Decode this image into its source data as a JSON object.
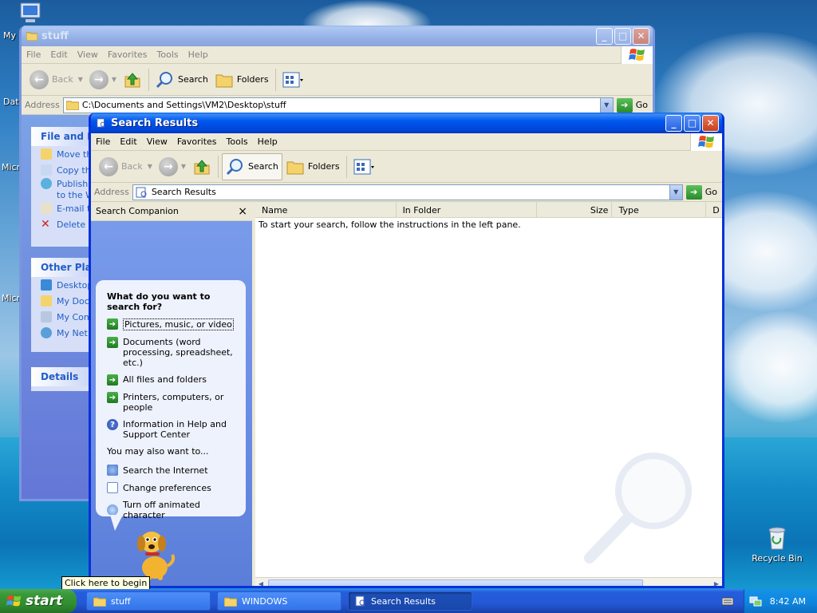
{
  "desktop": {
    "icons": [
      {
        "label": "My",
        "name": "my-computer-icon"
      },
      {
        "label": "Dat",
        "name": "data-icon"
      },
      {
        "label": "Micr",
        "name": "micr-icon-1"
      },
      {
        "label": "Micr",
        "name": "micr-icon-2"
      },
      {
        "label": "Recycle Bin",
        "name": "recycle-bin-icon"
      }
    ]
  },
  "stuff_window": {
    "title": "stuff",
    "menu": [
      "File",
      "Edit",
      "View",
      "Favorites",
      "Tools",
      "Help"
    ],
    "toolbar": {
      "back": "Back",
      "search": "Search",
      "folders": "Folders"
    },
    "address_label": "Address",
    "address_value": "C:\\Documents and Settings\\VM2\\Desktop\\stuff",
    "go": "Go",
    "file_tasks": {
      "header": "File and Fo",
      "items": [
        "Move th",
        "Copy th",
        "Publish",
        "to the W",
        "E-mail t",
        "Delete t"
      ]
    },
    "other_places": {
      "header": "Other Plac",
      "items": [
        "Desktop",
        "My Doc",
        "My Com",
        "My Net"
      ]
    },
    "details": {
      "header": "Details"
    }
  },
  "search_window": {
    "title": "Search Results",
    "menu": [
      "File",
      "Edit",
      "View",
      "Favorites",
      "Tools",
      "Help"
    ],
    "toolbar": {
      "back": "Back",
      "search": "Search",
      "folders": "Folders"
    },
    "address_label": "Address",
    "address_value": "Search Results",
    "go": "Go",
    "companion": {
      "title": "Search Companion",
      "close": "×",
      "question": "What do you want to search for?",
      "options": [
        "Pictures, music, or video",
        "Documents (word processing, spreadsheet, etc.)",
        "All files and folders",
        "Printers, computers, or people",
        "Information in Help and Support Center"
      ],
      "also_label": "You may also want to...",
      "also_options": [
        "Search the Internet",
        "Change preferences",
        "Turn off animated character"
      ]
    },
    "columns": [
      "Name",
      "In Folder",
      "Size",
      "Type",
      "D"
    ],
    "results_message": "To start your search, follow the instructions in the left pane."
  },
  "tooltip": "Click here to begin",
  "taskbar": {
    "start": "start",
    "tasks": [
      {
        "label": "stuff",
        "active": false
      },
      {
        "label": "WINDOWS",
        "active": false
      },
      {
        "label": "Search Results",
        "active": true
      }
    ],
    "clock": "8:42 AM"
  }
}
